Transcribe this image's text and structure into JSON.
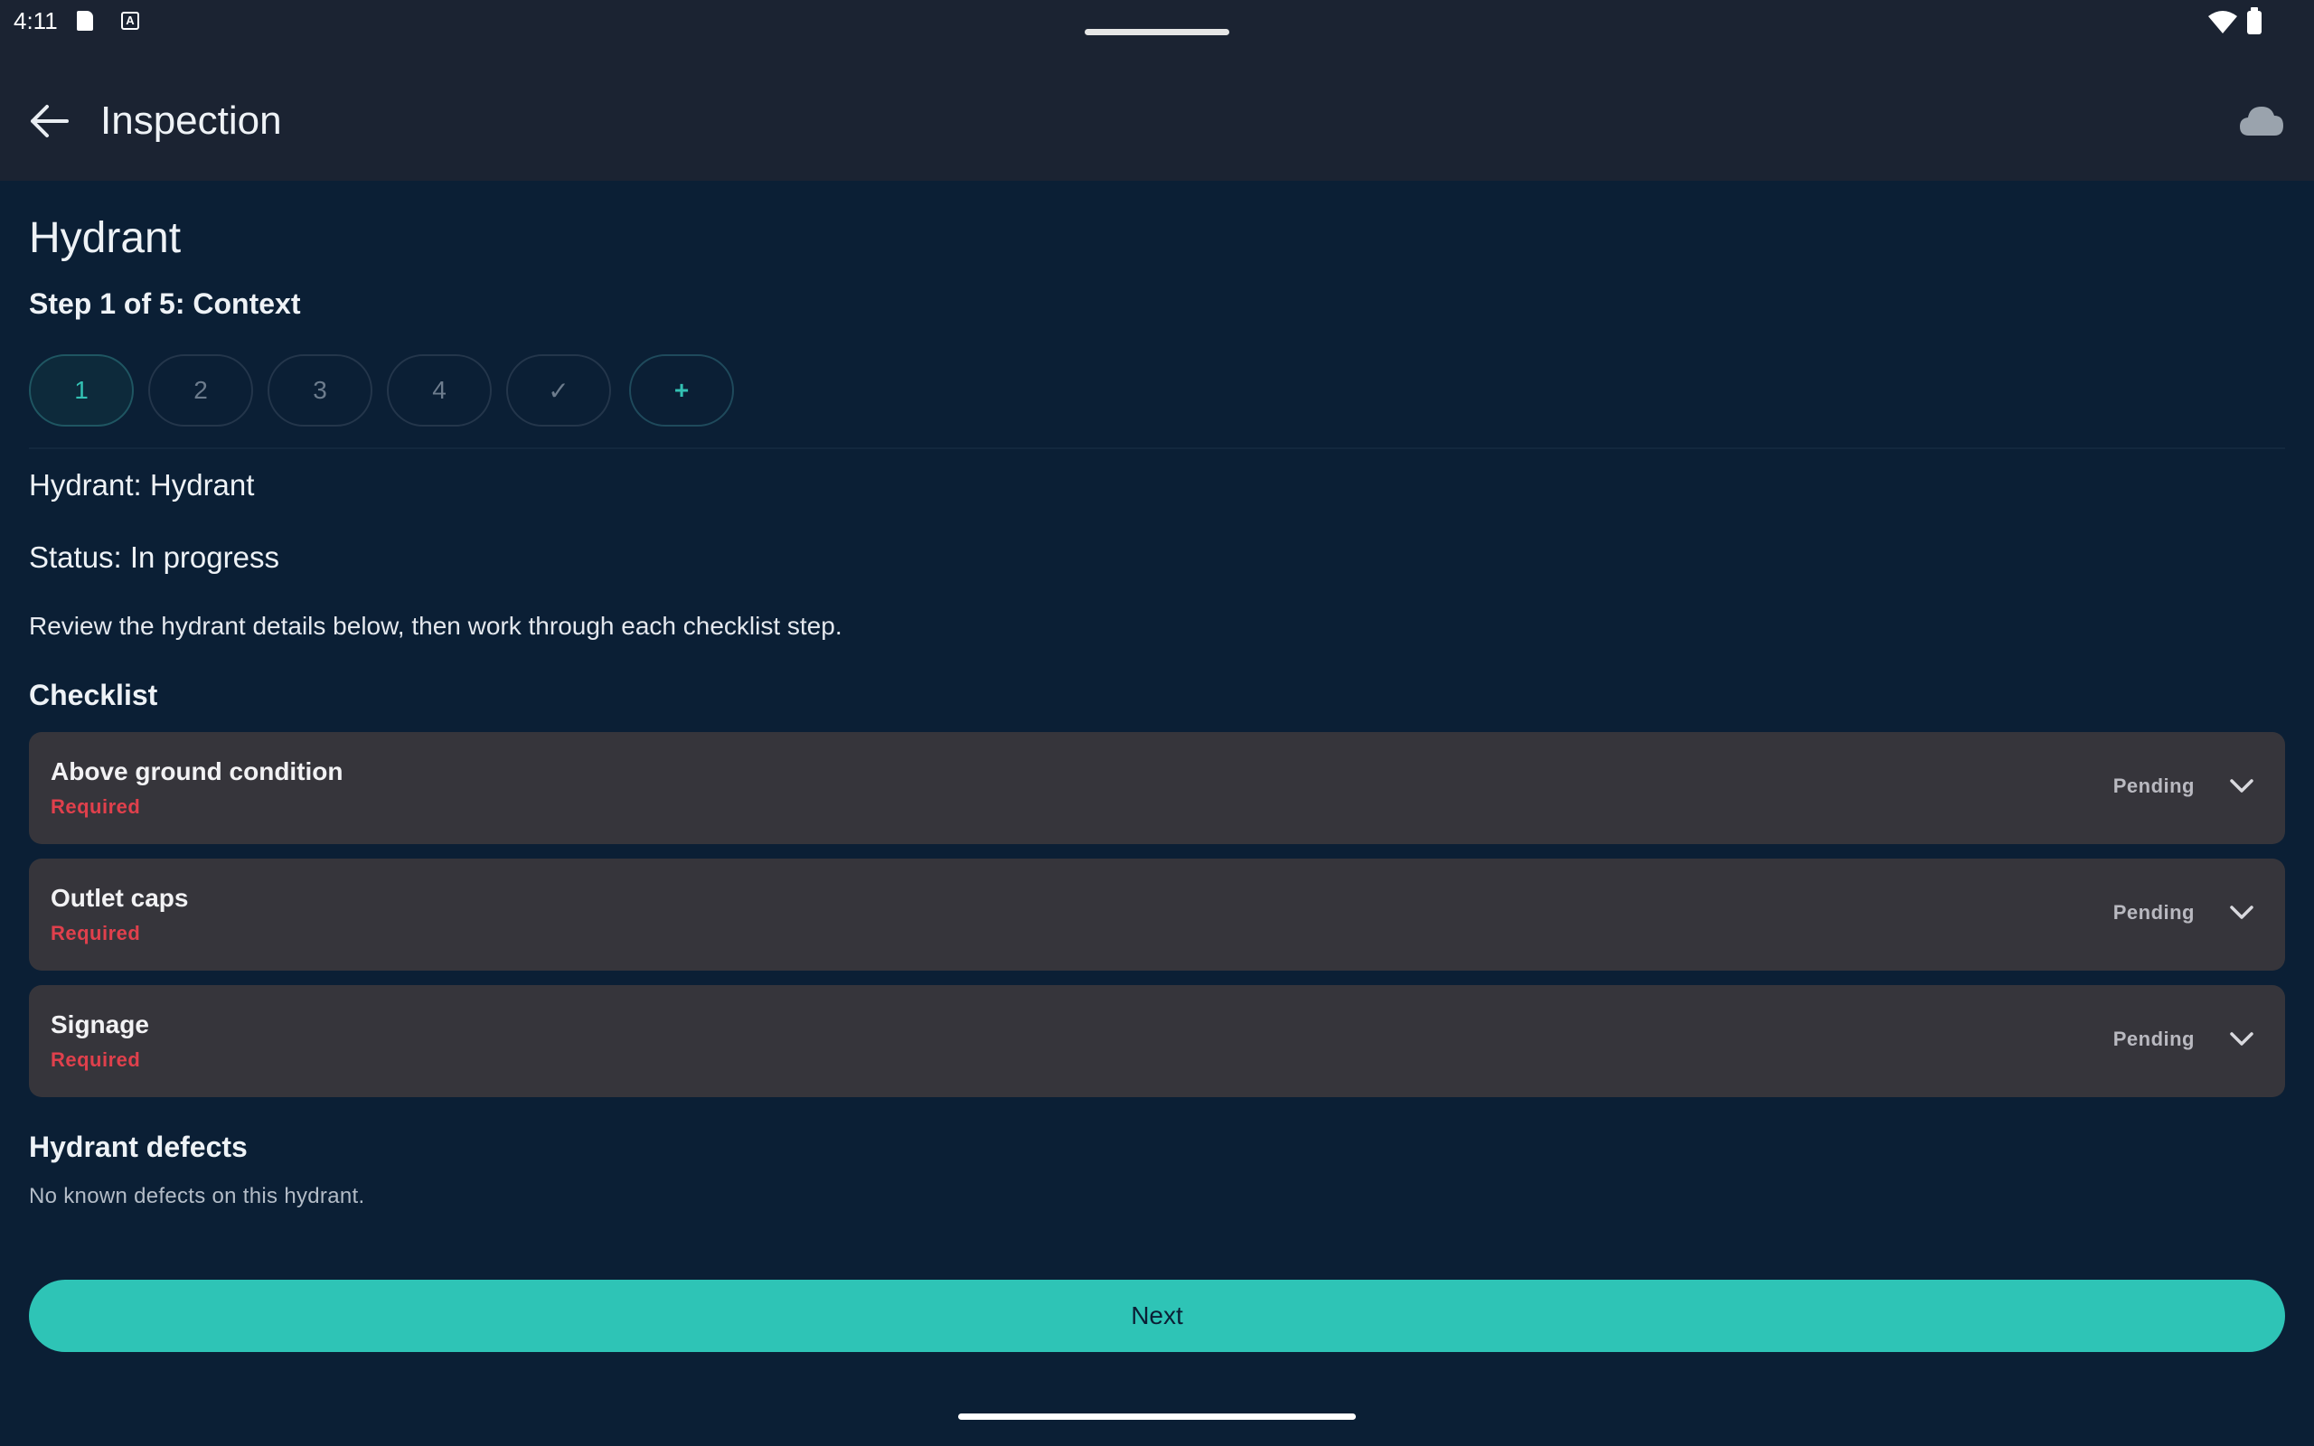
{
  "status_bar": {
    "time": "4:11",
    "icons": [
      "sd-card-icon",
      "a-icon",
      "wifi-icon",
      "battery-icon"
    ]
  },
  "app_bar": {
    "title": "Inspection",
    "back_icon": "arrow-left-icon",
    "sync_icon": "cloud-icon"
  },
  "page": {
    "heading": "Hydrant",
    "step_label": "Step 1 of 5: Context",
    "steps": [
      {
        "label": "1",
        "active": true
      },
      {
        "label": "2",
        "active": false
      },
      {
        "label": "3",
        "active": false
      },
      {
        "label": "4",
        "active": false
      },
      {
        "label": "✓",
        "active": false
      },
      {
        "label": "+",
        "active": false
      }
    ],
    "hydrant_line": "Hydrant: Hydrant",
    "status_line": "Status: In progress",
    "description": "Review the hydrant details below, then work through each checklist step.",
    "checklist_title": "Checklist",
    "checklist": [
      {
        "name": "Above ground condition",
        "requirement": "Required",
        "status": "Pending"
      },
      {
        "name": "Outlet caps",
        "requirement": "Required",
        "status": "Pending"
      },
      {
        "name": "Signage",
        "requirement": "Required",
        "status": "Pending"
      }
    ],
    "defects_title": "Hydrant defects",
    "defects_text": "No known defects on this hydrant.",
    "next_label": "Next"
  },
  "colors": {
    "background": "#0b1f35",
    "app_bar": "#1b2332",
    "accent": "#2ec4b6",
    "card": "#36353b",
    "required": "#e0404c"
  }
}
